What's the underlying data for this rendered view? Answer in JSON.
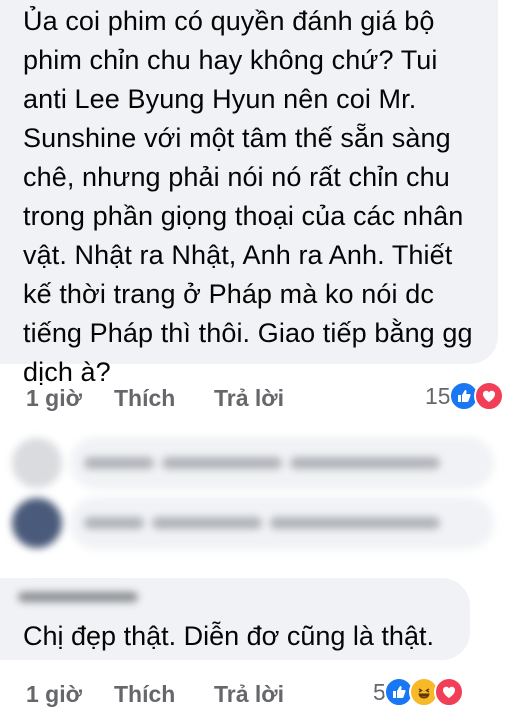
{
  "comment1": {
    "lines": [
      "Ủa coi phim có quyền đánh giá bộ",
      "phim chỉn chu hay không chứ? Tui",
      "anti Lee Byung Hyun nên coi Mr.",
      "Sunshine với một tâm thế sẵn sàng",
      "chê, nhưng phải nói nó rất chỉn chu",
      "trong phần giọng thoại của các nhân",
      "vật. Nhật ra Nhật, Anh ra Anh. Thiết",
      "kế thời trang ở Pháp mà ko nói dc",
      "tiếng Pháp thì thôi. Giao tiếp bằng gg",
      "dịch à?"
    ],
    "time": "1 giờ",
    "like_label": "Thích",
    "reply_label": "Trả lời",
    "reaction_count": "15",
    "reactions": [
      "like-reaction-icon",
      "love-reaction-icon"
    ]
  },
  "comment2": {
    "text": "Chị đẹp thật. Diễn đơ cũng là thật.",
    "time": "1 giờ",
    "like_label": "Thích",
    "reply_label": "Trả lời",
    "reaction_count": "5",
    "reactions": [
      "like-reaction-icon",
      "haha-reaction-icon",
      "love-reaction-icon"
    ]
  },
  "colors": {
    "bubble": "#f0f2f5",
    "meta_text": "#65676b",
    "like_blue": "#1877f2",
    "love_red": "#f33e58",
    "haha_yellow": "#f7b928"
  }
}
